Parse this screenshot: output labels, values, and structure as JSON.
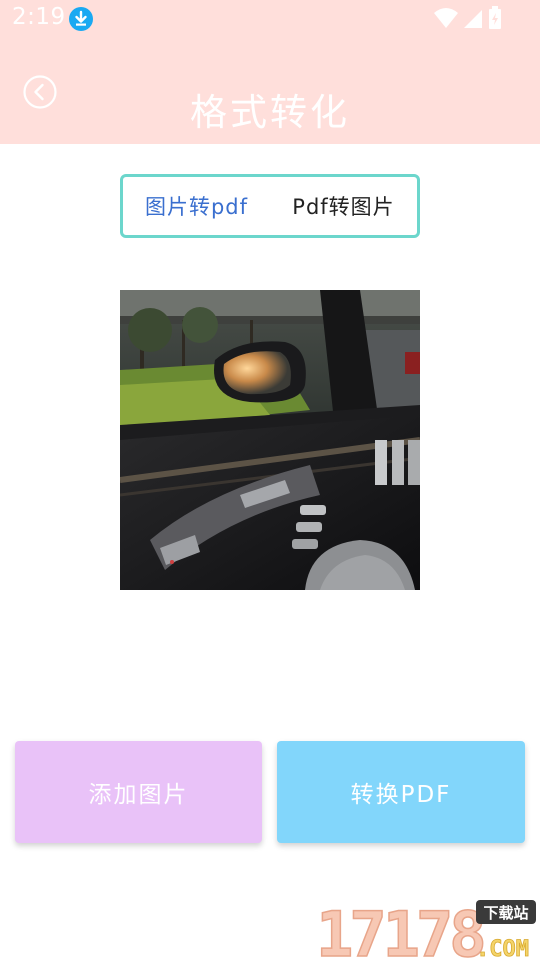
{
  "status_bar": {
    "time": "2:19"
  },
  "header": {
    "title": "格式转化"
  },
  "mode_switch": {
    "tabs": [
      {
        "label": "图片转pdf",
        "active": true
      },
      {
        "label": "Pdf转图片",
        "active": false
      }
    ]
  },
  "actions": {
    "add_label": "添加图片",
    "convert_label": "转换PDF"
  },
  "watermark": {
    "brand": "17178",
    "suffix": ".COM",
    "tag": "下载站"
  },
  "colors": {
    "header_bg": "#ffdfdb",
    "tab_border": "#6cd6cc",
    "tab_active": "#3a6fcf",
    "add_button": "#e9c2f8",
    "convert_button": "#82d6fb"
  }
}
